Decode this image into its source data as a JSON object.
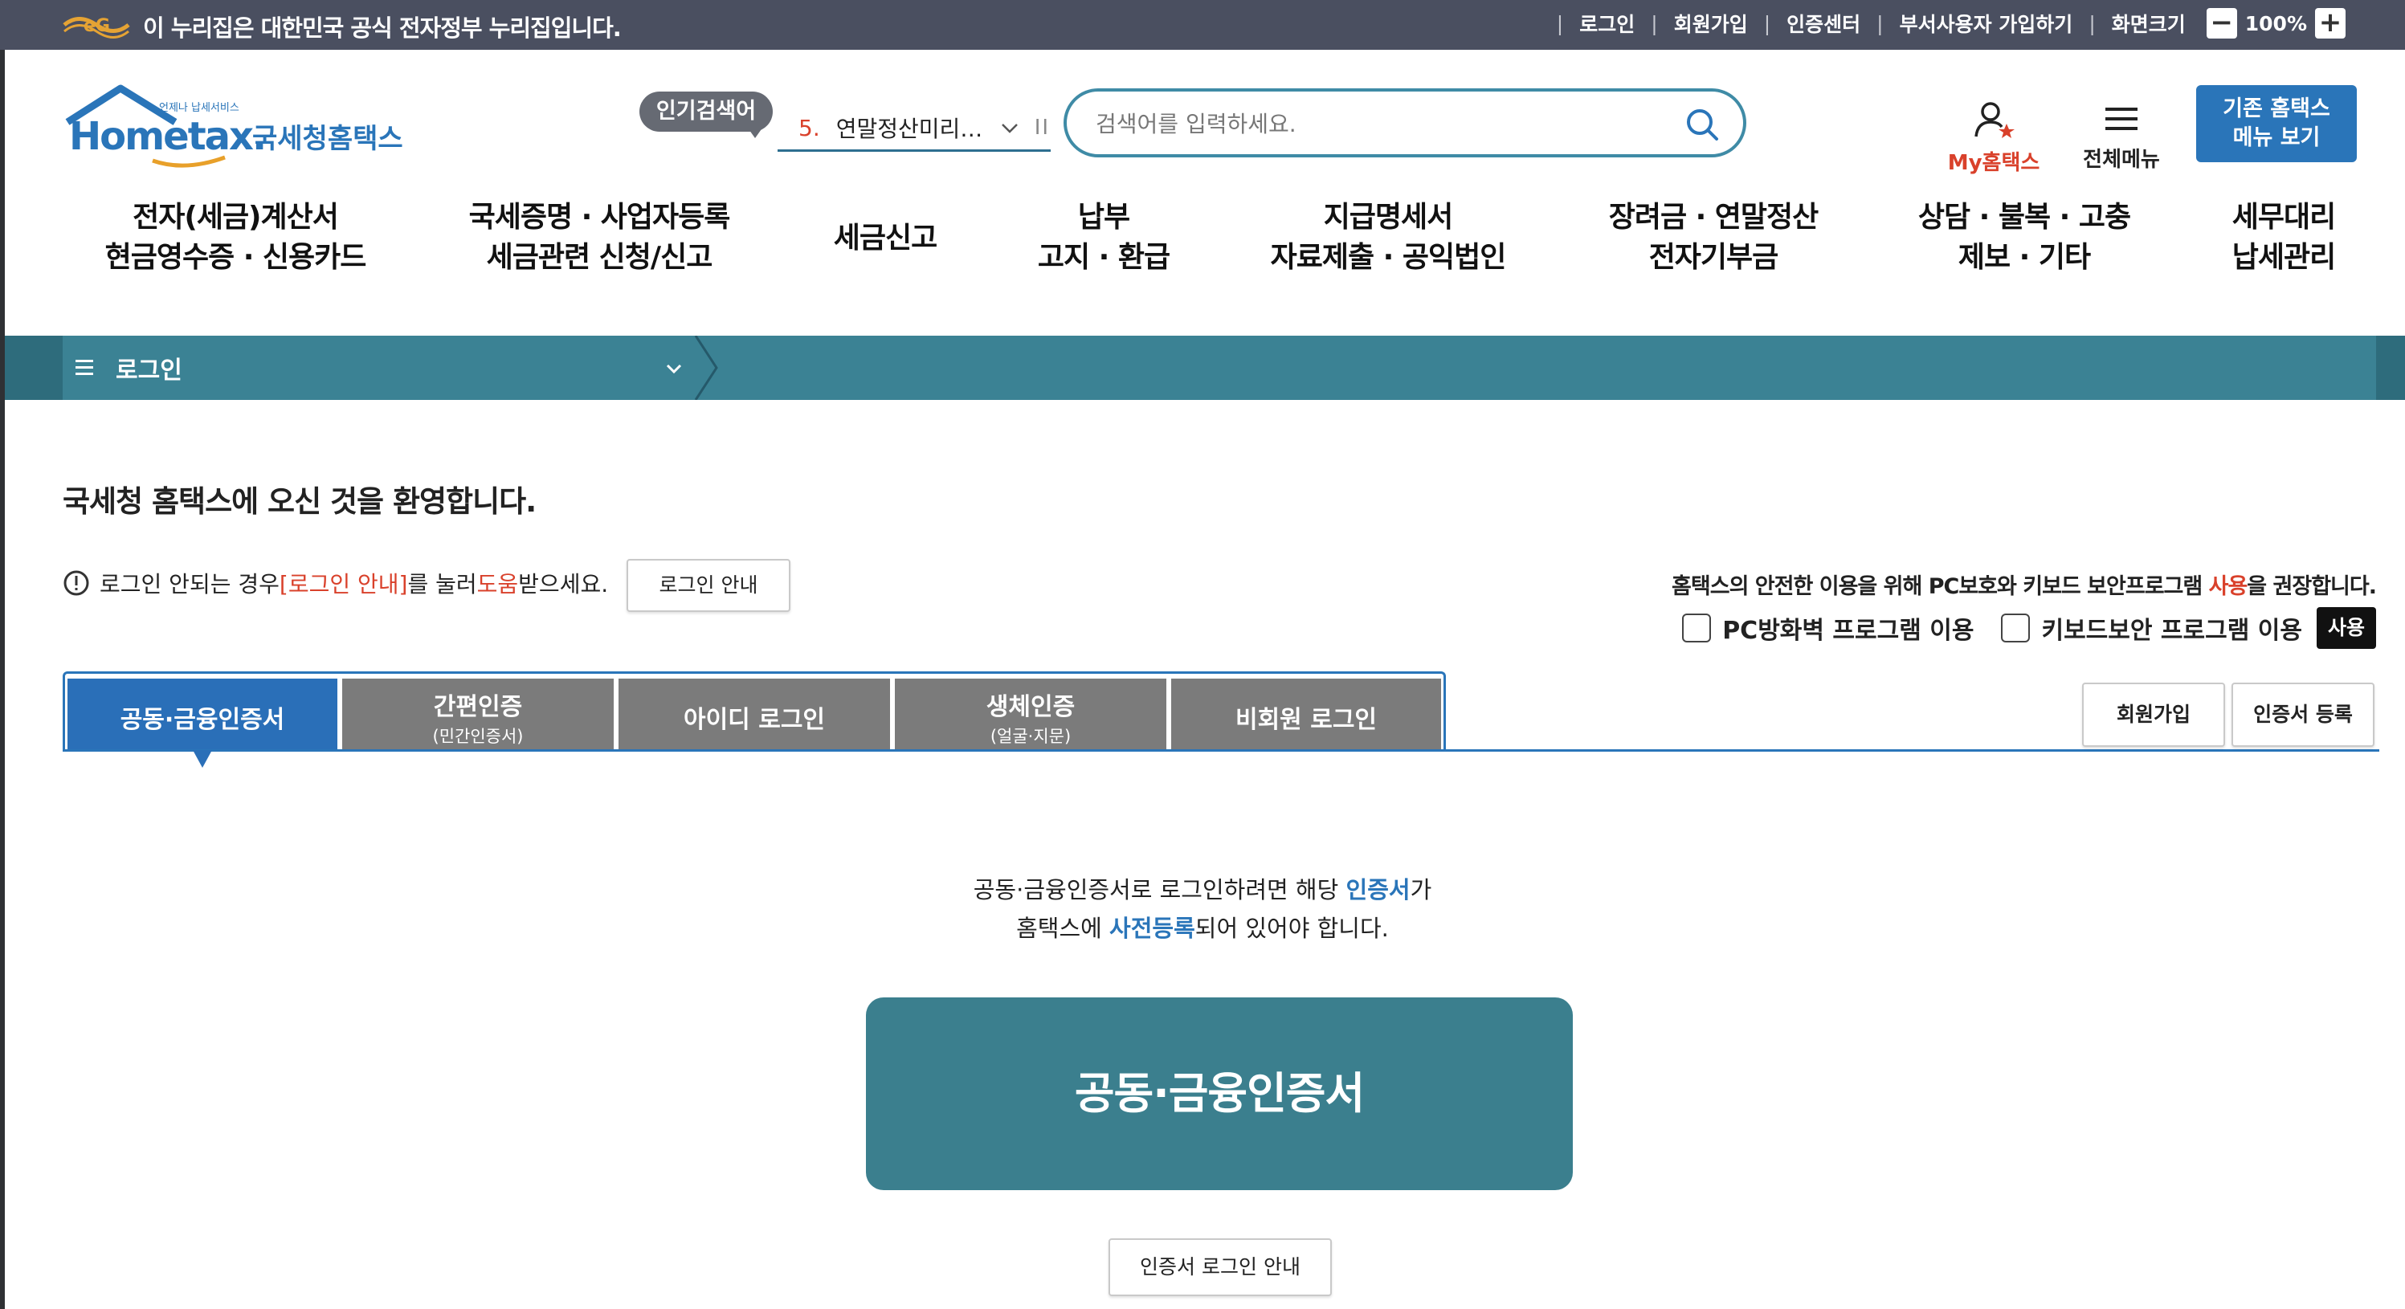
{
  "gov_banner": {
    "notice": "이 누리집은 대한민국 공식 전자정부 누리집입니다.",
    "links": [
      "로그인",
      "회원가입",
      "인증센터",
      "부서사용자 가입하기",
      "화면크기"
    ],
    "zoom_minus": "−",
    "zoom_value": "100%",
    "zoom_plus": "+"
  },
  "header": {
    "logo_text": "국세청홈택스",
    "logo_wordmark": "Hometax.",
    "logo_slogan": "언제나 납세서비스",
    "popular_badge": "인기검색어",
    "popular_rank": "5.",
    "popular_term": "연말정산미리…",
    "popular_pause": "II",
    "search_placeholder": "검색어를 입력하세요.",
    "my_hometax": "My홈택스",
    "all_menu": "전체메뉴",
    "legacy_line1": "기존 홈택스",
    "legacy_line2": "메뉴 보기"
  },
  "gnb": [
    {
      "line1": "전자(세금)계산서",
      "line2": "현금영수증 · 신용카드"
    },
    {
      "line1": "국세증명 · 사업자등록",
      "line2": "세금관련 신청/신고"
    },
    {
      "line1": "세금신고",
      "line2": ""
    },
    {
      "line1": "납부",
      "line2": "고지 · 환급"
    },
    {
      "line1": "지급명세서",
      "line2": "자료제출 · 공익법인"
    },
    {
      "line1": "장려금 · 연말정산",
      "line2": "전자기부금"
    },
    {
      "line1": "상담 · 불복 · 고충",
      "line2": "제보 · 기타"
    },
    {
      "line1": "세무대리",
      "line2": "납세관리"
    }
  ],
  "breadcrumb": {
    "current": "로그인"
  },
  "welcome": "국세청 홈택스에 오신 것을 환영합니다.",
  "help": {
    "pre": "로그인 안되는 경우 ",
    "link": "[로그인 안내]",
    "mid": "를 눌러 ",
    "emph": "도움",
    "post": "받으세요.",
    "button": "로그인 안내"
  },
  "security": {
    "note_pre": "홈택스의 안전한 이용을 위해 PC보호와 키보드 보안프로그램 ",
    "note_emph": "사용",
    "note_post": "을 권장합니다.",
    "opt1": "PC방화벽 프로그램 이용",
    "opt2": "키보드보안 프로그램 이용",
    "use_button": "사용"
  },
  "tabs": [
    {
      "label": "공동·금융인증서",
      "sub": "",
      "active": true
    },
    {
      "label": "간편인증",
      "sub": "(민간인증서)",
      "active": false
    },
    {
      "label": "아이디 로그인",
      "sub": "",
      "active": false
    },
    {
      "label": "생체인증",
      "sub": "(얼굴·지문)",
      "active": false
    },
    {
      "label": "비회원 로그인",
      "sub": "",
      "active": false
    }
  ],
  "side_buttons": {
    "join": "회원가입",
    "cert_register": "인증서 등록"
  },
  "cert_panel": {
    "line1_pre": "공동·금융인증서로 로그인하려면 해당 ",
    "line1_emph": "인증서",
    "line1_post": "가",
    "line2_pre": "홈택스에 ",
    "line2_emph": "사전등록",
    "line2_post": "되어 있어야 합니다.",
    "big_button": "공동·금융인증서",
    "guide_button": "인증서 로그인 안내"
  },
  "colors": {
    "gov_bar": "#4a4f60",
    "accent_blue": "#2a75b9",
    "teal": "#3b8294",
    "cert_button": "#3b7f8e",
    "emphasis_red": "#d9412b"
  }
}
